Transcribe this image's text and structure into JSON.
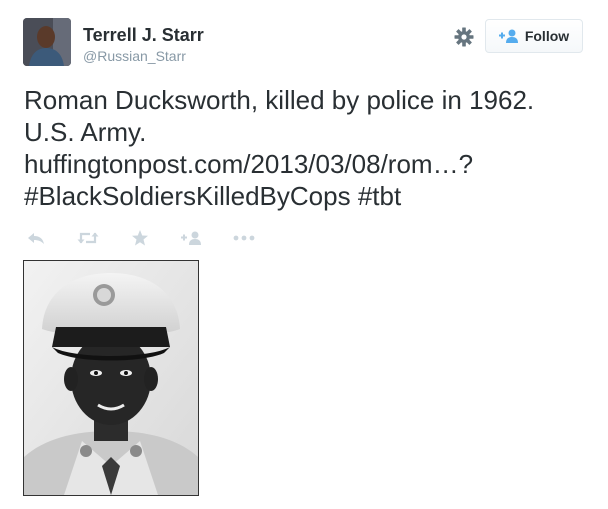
{
  "author": {
    "name": "Terrell J. Starr",
    "handle": "@Russian_Starr"
  },
  "follow_label": "Follow",
  "tweet": {
    "line1": "Roman Ducksworth, killed by police in 1962.",
    "line2": "U.S. Army.",
    "link": "huffingtonpost.com/2013/03/08/rom…?",
    "hashtag1": "#BlackSoldiersKilledByCops",
    "hashtag2": "#tbt"
  },
  "actions": [
    "reply-icon",
    "retweet-icon",
    "favorite-icon",
    "follow-icon",
    "more-icon"
  ],
  "colors": {
    "text": "#292f33",
    "muted": "#8899a6",
    "accent": "#55acee",
    "icon": "#ccd6dd"
  }
}
